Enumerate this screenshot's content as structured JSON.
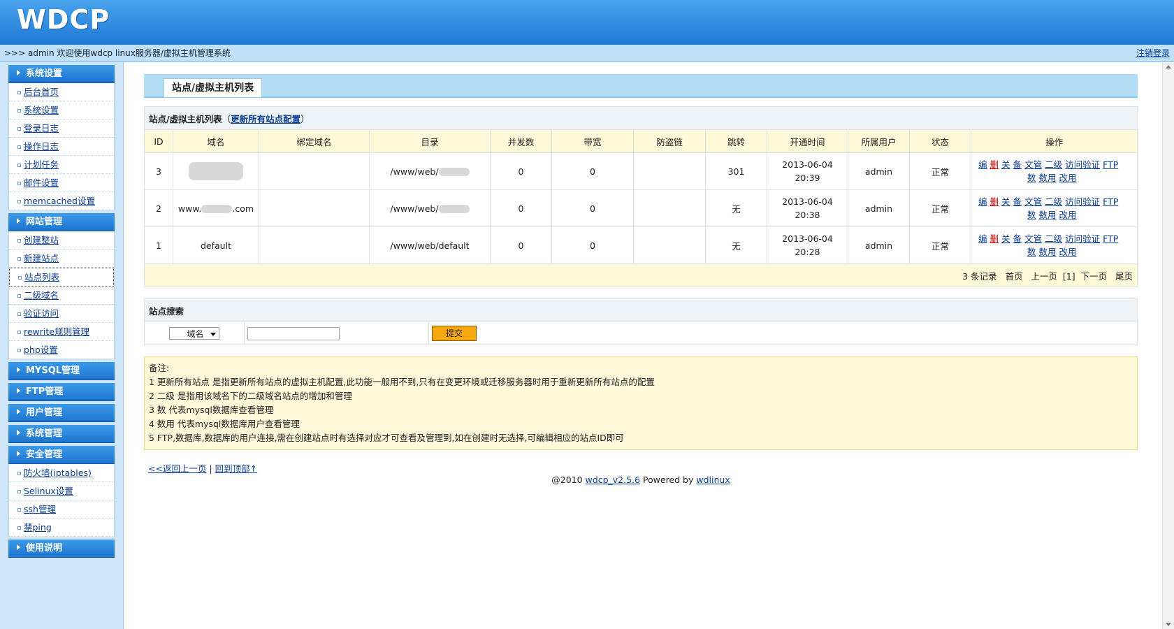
{
  "header": {
    "logo": "WDCP"
  },
  "infobar": {
    "welcome": ">>> admin 欢迎使用wdcp linux服务器/虚拟主机管理系统",
    "logout": "注销登录"
  },
  "sidebar": {
    "sections": [
      {
        "title": "系统设置",
        "items": [
          "后台首页",
          "系统设置",
          "登录日志",
          "操作日志",
          "计划任务",
          "邮件设置",
          "memcached设置"
        ]
      },
      {
        "title": "网站管理",
        "items": [
          "创建整站",
          "新建站点",
          "站点列表",
          "二级域名",
          "验证访问",
          "rewrite规则管理",
          "php设置"
        ]
      },
      {
        "title": "MYSQL管理"
      },
      {
        "title": "FTP管理"
      },
      {
        "title": "用户管理"
      },
      {
        "title": "系统管理"
      },
      {
        "title": "安全管理",
        "items": [
          "防火墙(iptables)",
          "Selinux设置",
          "ssh管理",
          "禁ping"
        ]
      },
      {
        "title": "使用说明"
      }
    ]
  },
  "main": {
    "tab": "站点/虚拟主机列表",
    "list": {
      "caption": "站点/虚拟主机列表",
      "caption_paren_open": "（",
      "caption_link": "更新所有站点配置",
      "caption_paren_close": "）",
      "columns": [
        "ID",
        "域名",
        "绑定域名",
        "目录",
        "并发数",
        "带宽",
        "防盗链",
        "跳转",
        "开通时间",
        "所属用户",
        "状态",
        "操作"
      ],
      "rows": [
        {
          "id": "3",
          "domain": "",
          "bind": "",
          "dir": "/www/web/",
          "conc": "0",
          "bw": "0",
          "anti": "",
          "jump": "301",
          "date": "2013-06-04",
          "time": "20:39",
          "user": "admin",
          "status": "正常"
        },
        {
          "id": "2",
          "domain_prefix": "www.",
          "domain_suffix": ".com",
          "bind": "",
          "dir": "/www/web/",
          "conc": "0",
          "bw": "0",
          "anti": "",
          "jump": "无",
          "date": "2013-06-04",
          "time": "20:38",
          "user": "admin",
          "status": "正常"
        },
        {
          "id": "1",
          "domain": "default",
          "bind": "",
          "dir": "/www/web/default",
          "conc": "0",
          "bw": "0",
          "anti": "",
          "jump": "无",
          "date": "2013-06-04",
          "time": "20:28",
          "user": "admin",
          "status": "正常"
        }
      ],
      "ops": {
        "edit": "编",
        "del": "删",
        "close": "关",
        "backup": "备",
        "file": "文管",
        "sub": "二级",
        "auth": "访问验证",
        "ftp": "FTP",
        "db": "数",
        "dbuser": "数用",
        "chg": "改用"
      },
      "pager": {
        "count": "3 条记录",
        "first": "首页",
        "prev": "上一页",
        "current": "[1]",
        "next": "下一页",
        "last": "尾页"
      }
    },
    "search": {
      "title": "站点搜索",
      "select_value": "域名",
      "submit": "提交",
      "input_value": ""
    },
    "notes": {
      "title": "备注:",
      "lines": [
        "1 更新所有站点 是指更新所有站点的虚拟主机配置,此功能一般用不到,只有在变更环境或迁移服务器时用于重新更新所有站点的配置",
        "2 二级 是指用该域名下的二级域名站点的增加和管理",
        "3 数 代表mysql数据库查看管理",
        "4 数用 代表mysql数据库用户查看管理",
        "5 FTP,数据库,数据库的用户连接,需在创建站点时有选择对应才可查看及管理到,如在创建时无选择,可编辑相应的站点ID即可"
      ]
    },
    "footer": {
      "back": "<<返回上一页",
      "sep": "|",
      "top": "回到顶部↑",
      "copy_prefix": "@2010 ",
      "version": "wdcp_v2.5.6",
      "powered": " Powered by ",
      "wdlinux": "wdlinux"
    }
  }
}
